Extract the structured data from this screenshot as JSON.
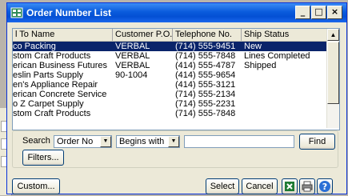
{
  "window": {
    "title": "Order Number List"
  },
  "columns": [
    "l To Name",
    "Customer P.O.",
    "Telephone No.",
    "Ship Status"
  ],
  "rows": [
    {
      "name": "co Packing",
      "po": "VERBAL",
      "phone": "(714) 555-9451",
      "status": "New",
      "selected": true
    },
    {
      "name": "stom Craft Products",
      "po": "VERBAL",
      "phone": "(714) 555-7848",
      "status": "Lines Completed"
    },
    {
      "name": "erican Business Futures",
      "po": "VERBAL",
      "phone": "(414) 555-4787",
      "status": "Shipped"
    },
    {
      "name": "eslin Parts Supply",
      "po": "90-1004",
      "phone": "(414) 555-9654",
      "status": ""
    },
    {
      "name": "en's Appliance Repair",
      "po": "",
      "phone": "(414) 555-3121",
      "status": ""
    },
    {
      "name": "erican Concrete Service",
      "po": "",
      "phone": "(714) 555-2134",
      "status": ""
    },
    {
      "name": "o Z Carpet Supply",
      "po": "",
      "phone": "(714) 555-2231",
      "status": ""
    },
    {
      "name": "stom Craft Products",
      "po": "",
      "phone": "(714) 555-7848",
      "status": ""
    }
  ],
  "search": {
    "label": "Search",
    "field_value": "Order No",
    "operator_value": "Begins with",
    "text_value": "",
    "find_label": "Find",
    "filters_label": "Filters..."
  },
  "footer": {
    "custom_label": "Custom...",
    "select_label": "Select",
    "cancel_label": "Cancel"
  },
  "colors": {
    "title_bar": "#0a5bdc",
    "selection": "#0a246a",
    "window_border": "#0831d9"
  }
}
